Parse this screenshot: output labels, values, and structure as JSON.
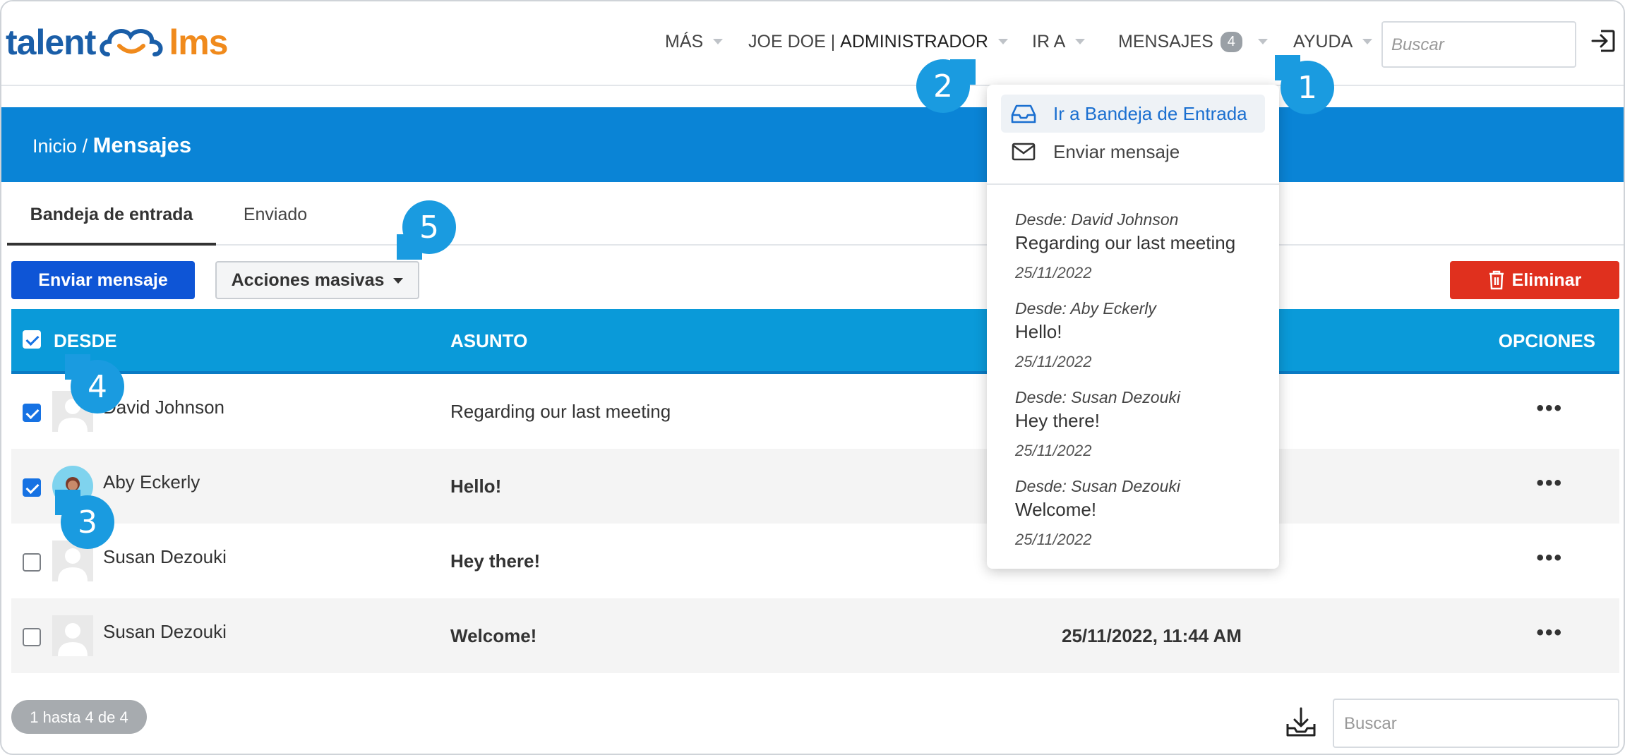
{
  "logo": {
    "part1": "talent",
    "part2": "lms"
  },
  "nav": {
    "mas": "MÁS",
    "user_name": "JOE DOE",
    "separator": "|",
    "user_role": "ADMINISTRADOR",
    "ir_a": "IR A",
    "mensajes": "MENSAJES",
    "mensajes_count": "4",
    "ayuda": "AYUDA",
    "search_placeholder": "Buscar"
  },
  "breadcrumb": {
    "home": "Inicio /",
    "current": "Mensajes"
  },
  "tabs": [
    {
      "label": "Bandeja de entrada"
    },
    {
      "label": "Enviado"
    }
  ],
  "toolbar": {
    "send": "Enviar mensaje",
    "bulk": "Acciones masivas",
    "delete": "Eliminar"
  },
  "table": {
    "headers": {
      "desde": "DESDE",
      "asunto": "ASUNTO",
      "opciones": "OPCIONES"
    },
    "rows": [
      {
        "from": "David Johnson",
        "subject": "Regarding our last meeting",
        "checked": true,
        "date": ""
      },
      {
        "from": "Aby Eckerly",
        "subject": "Hello!",
        "checked": true,
        "date": ""
      },
      {
        "from": "Susan Dezouki",
        "subject": "Hey there!",
        "checked": false,
        "date": ""
      },
      {
        "from": "Susan Dezouki",
        "subject": "Welcome!",
        "checked": false,
        "date": "25/11/2022, 11:44 AM"
      }
    ],
    "options_glyph": "•••"
  },
  "footer": {
    "pager": "1 hasta 4 de 4",
    "search_placeholder": "Buscar"
  },
  "dropdown": {
    "inbox": "Ir a Bandeja de Entrada",
    "send": "Enviar mensaje",
    "messages": [
      {
        "from": "Desde: David Johnson",
        "subject": "Regarding our last meeting",
        "date": "25/11/2022"
      },
      {
        "from": "Desde: Aby Eckerly",
        "subject": "Hello!",
        "date": "25/11/2022"
      },
      {
        "from": "Desde: Susan Dezouki",
        "subject": "Hey there!",
        "date": "25/11/2022"
      },
      {
        "from": "Desde: Susan Dezouki",
        "subject": "Welcome!",
        "date": "25/11/2022"
      }
    ]
  },
  "callouts": [
    "1",
    "2",
    "3",
    "4",
    "5"
  ],
  "colors": {
    "brand_blue": "#0a84d6",
    "table_header": "#0a9ad9",
    "send_button": "#0e55d6",
    "delete_button": "#e0301e",
    "callout": "#1a9be0"
  }
}
